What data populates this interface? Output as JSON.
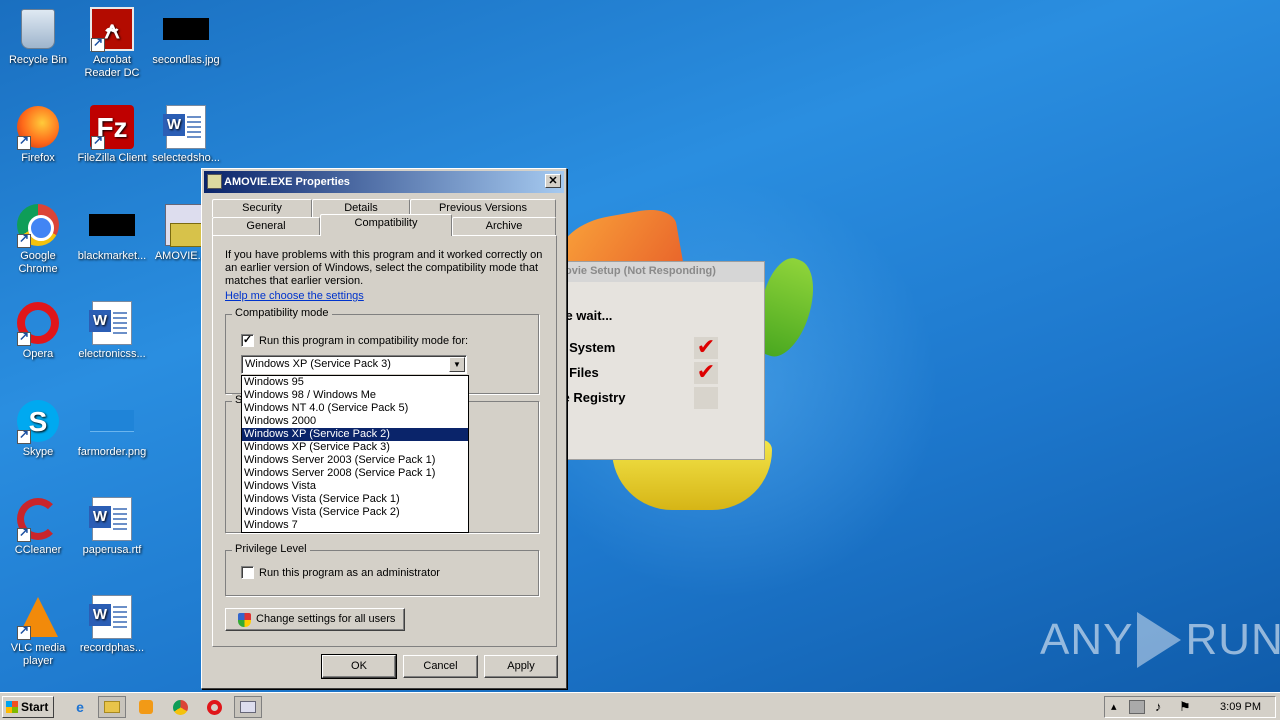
{
  "desktop": {
    "icons": [
      {
        "label": "Recycle Bin",
        "icon": "recycle-bin-icon"
      },
      {
        "label": "Acrobat Reader DC",
        "icon": "acrobat-icon"
      },
      {
        "label": "secondlas.jpg",
        "icon": "image-file-icon"
      },
      {
        "label": "Firefox",
        "icon": "firefox-icon"
      },
      {
        "label": "FileZilla Client",
        "icon": "filezilla-icon"
      },
      {
        "label": "selectedsho...",
        "icon": "word-doc-icon"
      },
      {
        "label": "Google Chrome",
        "icon": "chrome-icon"
      },
      {
        "label": "blackmarket...",
        "icon": "image-file-icon"
      },
      {
        "label": "AMOVIE.E...",
        "icon": "setup-icon"
      },
      {
        "label": "Opera",
        "icon": "opera-icon"
      },
      {
        "label": "electronicss...",
        "icon": "word-doc-icon"
      },
      {
        "label": "Skype",
        "icon": "skype-icon"
      },
      {
        "label": "farmorder.png",
        "icon": "image-file-icon"
      },
      {
        "label": "CCleaner",
        "icon": "ccleaner-icon"
      },
      {
        "label": "paperusa.rtf",
        "icon": "word-doc-icon"
      },
      {
        "label": "VLC media player",
        "icon": "vlc-icon"
      },
      {
        "label": "recordphas...",
        "icon": "word-doc-icon"
      }
    ]
  },
  "background_window": {
    "title": "ovie Setup (Not Responding)",
    "status": "ase wait...",
    "rows": [
      "ck System",
      "all Files",
      "ate Registry"
    ],
    "check_mark": "✔"
  },
  "dialog": {
    "title": "AMOVIE.EXE Properties",
    "close_glyph": "✕",
    "tabs_row1": [
      "Security",
      "Details",
      "Previous Versions"
    ],
    "tabs_row2": [
      "General",
      "Compatibility",
      "Archive"
    ],
    "active_tab": "Compatibility",
    "intro": "If you have problems with this program and it worked correctly on an earlier version of Windows, select the compatibility mode that matches that earlier version.",
    "help_link": "Help me choose the settings",
    "compat_group": "Compatibility mode",
    "compat_checkbox": "Run this program in compatibility mode for:",
    "compat_checked": true,
    "combo_value": "Windows XP (Service Pack 3)",
    "combo_arrow": "▼",
    "settings_group_letter": "S",
    "dropdown_options": [
      "Windows 95",
      "Windows 98 / Windows Me",
      "Windows NT 4.0 (Service Pack 5)",
      "Windows 2000",
      "Windows XP (Service Pack 2)",
      "Windows XP (Service Pack 3)",
      "Windows Server 2003 (Service Pack 1)",
      "Windows Server 2008 (Service Pack 1)",
      "Windows Vista",
      "Windows Vista (Service Pack 1)",
      "Windows Vista (Service Pack 2)",
      "Windows 7"
    ],
    "dropdown_highlighted": "Windows XP (Service Pack 2)",
    "privilege_group": "Privilege Level",
    "admin_checkbox": "Run this program as an administrator",
    "admin_checked": false,
    "change_all_users": "Change settings for all users",
    "ok": "OK",
    "cancel": "Cancel",
    "apply": "Apply"
  },
  "watermark": {
    "left": "ANY",
    "right": "RUN"
  },
  "taskbar": {
    "start": "Start",
    "clock": "3:09 PM",
    "pinned": [
      "internet-explorer-icon",
      "explorer-folder-icon",
      "media-player-icon",
      "chrome-icon",
      "opera-icon",
      "setup-window-icon"
    ],
    "tray_icons": [
      "show-hidden-icon",
      "network-icon",
      "volume-icon",
      "action-center-flag-icon"
    ]
  }
}
